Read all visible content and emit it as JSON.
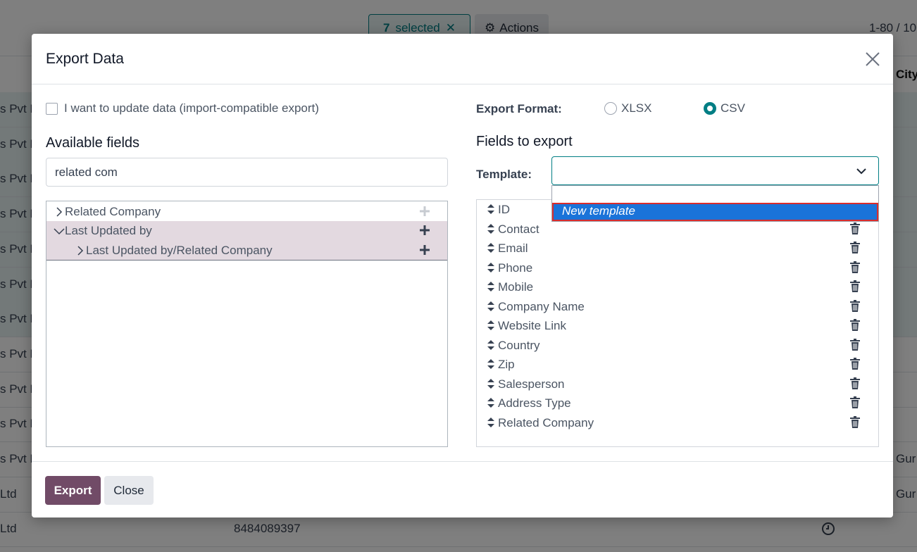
{
  "background": {
    "selection": {
      "count": "7",
      "label": "selected"
    },
    "actions_label": "Actions",
    "pager": "1-80 / 10",
    "city_header": "City",
    "rows": [
      {
        "name": "s Pvt L",
        "phone": "",
        "city": ""
      },
      {
        "name": "s Pvt L",
        "phone": "",
        "city": ""
      },
      {
        "name": "s Pvt L",
        "phone": "",
        "city": ""
      },
      {
        "name": "s Pvt L",
        "phone": "",
        "city": ""
      },
      {
        "name": "s Pvt L",
        "phone": "",
        "city": ""
      },
      {
        "name": "s Pvt L",
        "phone": "",
        "city": ""
      },
      {
        "name": "s Pvt L",
        "phone": "",
        "city": ""
      },
      {
        "name": "s Pvt L",
        "phone": "",
        "city": ""
      },
      {
        "name": "s Pvt L",
        "phone": "",
        "city": ""
      },
      {
        "name": "s Pvt L",
        "phone": "",
        "city": ""
      },
      {
        "name": "s Pvt L",
        "phone": "",
        "city": "Gur"
      },
      {
        "name": "Ltd",
        "phone": "",
        "city": "Gur"
      },
      {
        "name": "Ltd",
        "phone": "8484089397",
        "city": ""
      }
    ]
  },
  "modal": {
    "title": "Export Data",
    "import_compatible_label": "I want to update data (import-compatible export)",
    "available_fields_title": "Available fields",
    "search_value": "related com",
    "tree": [
      {
        "label": "Related Company",
        "expanded": false
      },
      {
        "label": "Last Updated by",
        "expanded": true
      },
      {
        "label": "Last Updated by/Related Company",
        "expanded": false
      }
    ],
    "export_format_label": "Export Format:",
    "formats": [
      {
        "label": "XLSX",
        "checked": false
      },
      {
        "label": "CSV",
        "checked": true
      }
    ],
    "fields_to_export_title": "Fields to export",
    "template_label": "Template:",
    "template_value": "",
    "template_options": [
      "",
      "New template"
    ],
    "fields": [
      "ID",
      "Contact",
      "Email",
      "Phone",
      "Mobile",
      "Company Name",
      "Website Link",
      "Country",
      "Zip",
      "Salesperson",
      "Address Type",
      "Related Company"
    ],
    "export_button": "Export",
    "close_button": "Close"
  },
  "colors": {
    "primary": "#714b67",
    "accent": "#017e84",
    "highlight_row": "#e3d9e0",
    "dropdown_active": "#1a73d9",
    "dropdown_outline": "#d92d2d"
  }
}
